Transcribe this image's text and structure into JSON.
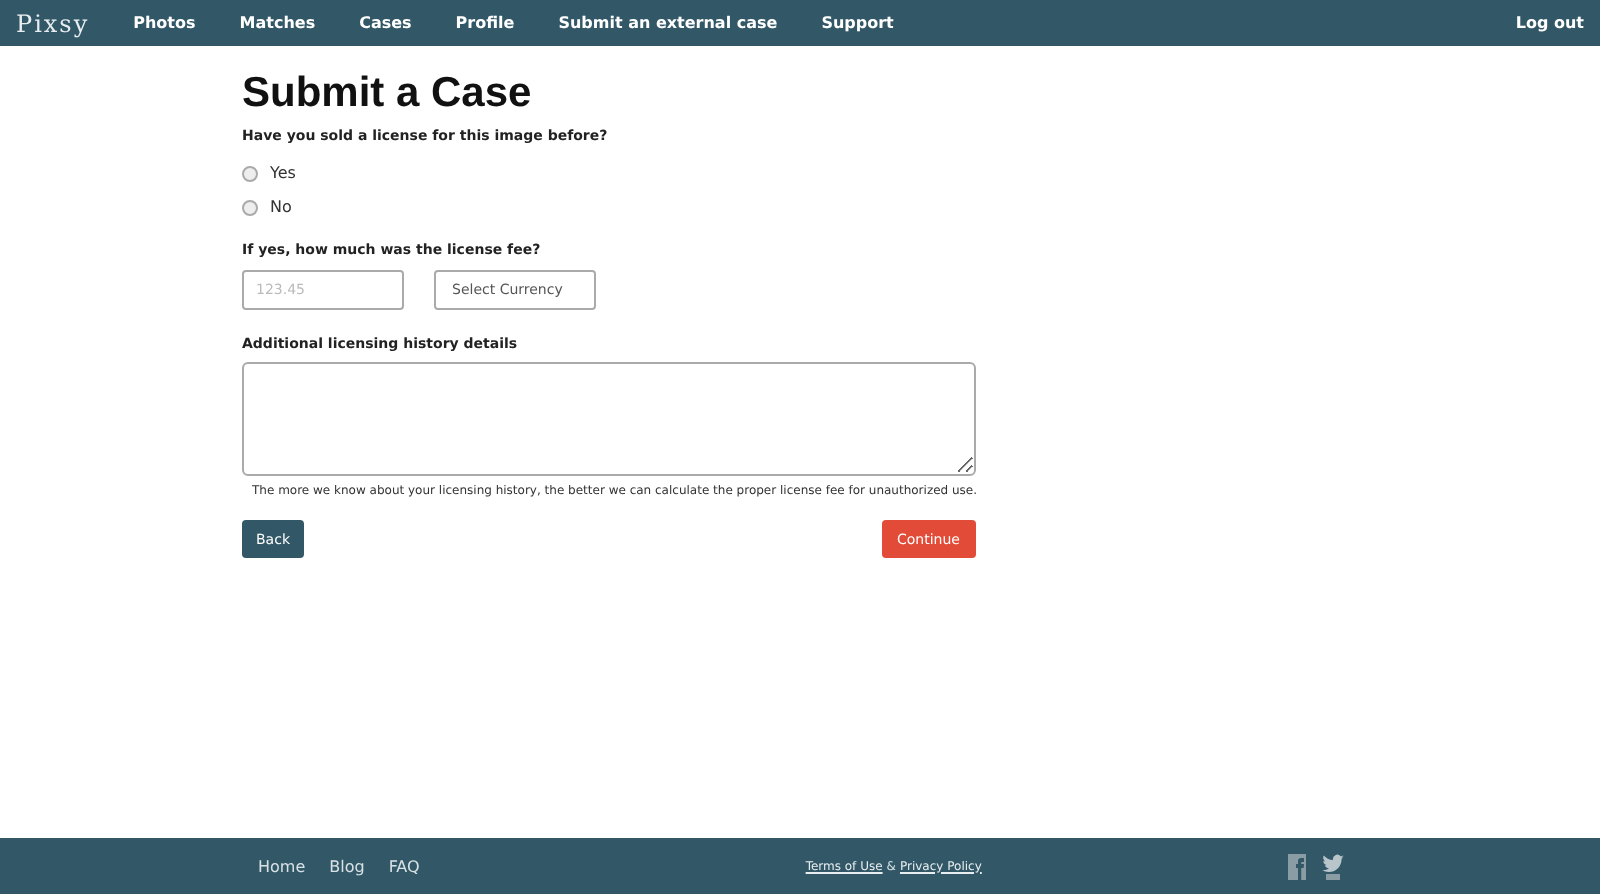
{
  "nav": {
    "logo": "Pixsy",
    "items": [
      {
        "label": "Photos"
      },
      {
        "label": "Matches"
      },
      {
        "label": "Cases"
      },
      {
        "label": "Profile"
      },
      {
        "label": "Submit an external case"
      },
      {
        "label": "Support"
      }
    ],
    "logout": "Log out"
  },
  "form": {
    "title": "Submit a Case",
    "question": "Have you sold a license for this image before?",
    "options": [
      {
        "label": "Yes",
        "selected": false
      },
      {
        "label": "No",
        "selected": false
      }
    ],
    "fee_label": "If yes, how much was the license fee?",
    "fee_placeholder": "123.45",
    "currency": "Select Currency",
    "details_label": "Additional licensing history details",
    "details_hint": "The more we know about your licensing history, the better we can calculate the proper license fee for unauthorized use.",
    "back": "Back",
    "continue": "Continue"
  },
  "footer": {
    "links": [
      {
        "label": "Home"
      },
      {
        "label": "Blog"
      },
      {
        "label": "FAQ"
      }
    ],
    "terms": "Terms of Use",
    "amp": "&",
    "privacy": "Privacy Policy"
  }
}
